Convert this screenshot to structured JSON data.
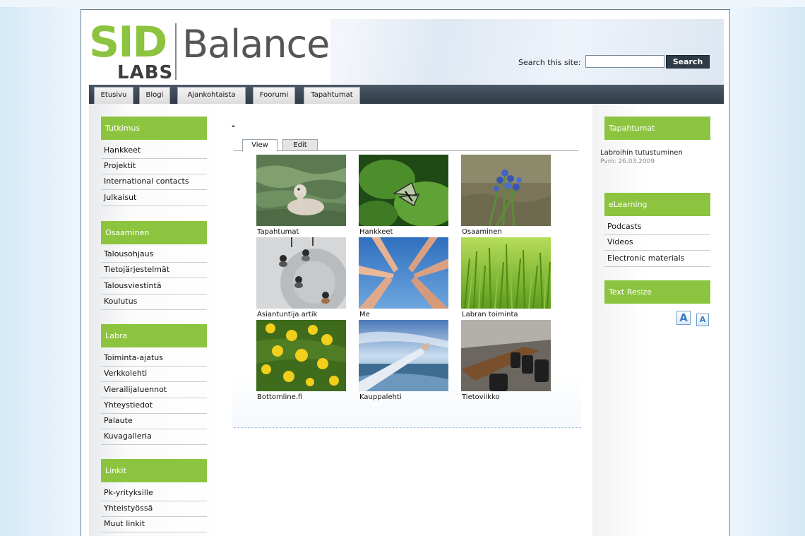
{
  "header": {
    "logo_sid": "SID",
    "logo_labs": "LABS",
    "logo_balance": "Balance",
    "search_label": "Search this site:",
    "search_value": "",
    "search_button": "Search"
  },
  "nav": {
    "tabs": [
      "Etusivu",
      "Blogi",
      "Ajankohtaista",
      "Foorumi",
      "Tapahtumat"
    ]
  },
  "left": {
    "sections": [
      {
        "title": "Tutkimus",
        "items": [
          "Hankkeet",
          "Projektit",
          "International contacts",
          "Julkaisut"
        ]
      },
      {
        "title": "Osaaminen",
        "items": [
          "Talousohjaus",
          "Tietojärjestelmät",
          "Talousviestintä",
          "Koulutus"
        ]
      },
      {
        "title": "Labra",
        "items": [
          "Toiminta-ajatus",
          "Verkkolehti",
          "Vierailijaluennot",
          "Yhteystiedot",
          "Palaute",
          "Kuvagalleria"
        ]
      },
      {
        "title": "Linkit",
        "items": [
          "Pk-yrityksille",
          "Yhteistyössä",
          "Muut linkit"
        ]
      }
    ]
  },
  "main": {
    "title": "-",
    "tabs": [
      "View",
      "Edit"
    ],
    "gallery": [
      {
        "caption": "Tapahtumat",
        "icon": "swan-photo"
      },
      {
        "caption": "Hankkeet",
        "icon": "butterfly-photo"
      },
      {
        "caption": "Osaaminen",
        "icon": "bluebell-flowers-photo"
      },
      {
        "caption": "Asiantuntija artik",
        "icon": "overhead-people-photo"
      },
      {
        "caption": "Me",
        "icon": "hands-sky-photo"
      },
      {
        "caption": "Labran toiminta",
        "icon": "grass-photo"
      },
      {
        "caption": "Bottomline.fi",
        "icon": "dandelions-photo"
      },
      {
        "caption": "Kauppalehti",
        "icon": "arm-sea-photo"
      },
      {
        "caption": "Tietoviikko",
        "icon": "boardroom-photo"
      }
    ]
  },
  "right": {
    "events_title": "Tapahtumat",
    "event": {
      "title": "Labroihin tutustuminen",
      "date": "Pvm: 26.03.2009"
    },
    "elearning_title": "eLearning",
    "elearning_items": [
      "Podcasts",
      "Videos",
      "Electronic materials"
    ],
    "resize_title": "Text Resize",
    "resize_large": "A",
    "resize_small": "A"
  },
  "colors": {
    "accent_green": "#8cc43f",
    "nav_dark": "#2f3b47"
  }
}
